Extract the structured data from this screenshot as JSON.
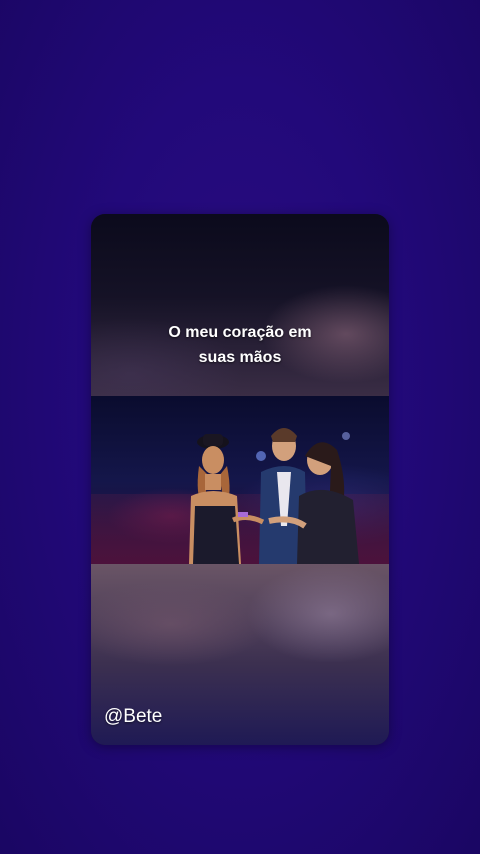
{
  "story": {
    "caption_line1": "O meu  coração  em",
    "caption_line2": "suas mãos",
    "username": "@Bete"
  },
  "colors": {
    "background": "#22097a",
    "text": "#ffffff"
  }
}
